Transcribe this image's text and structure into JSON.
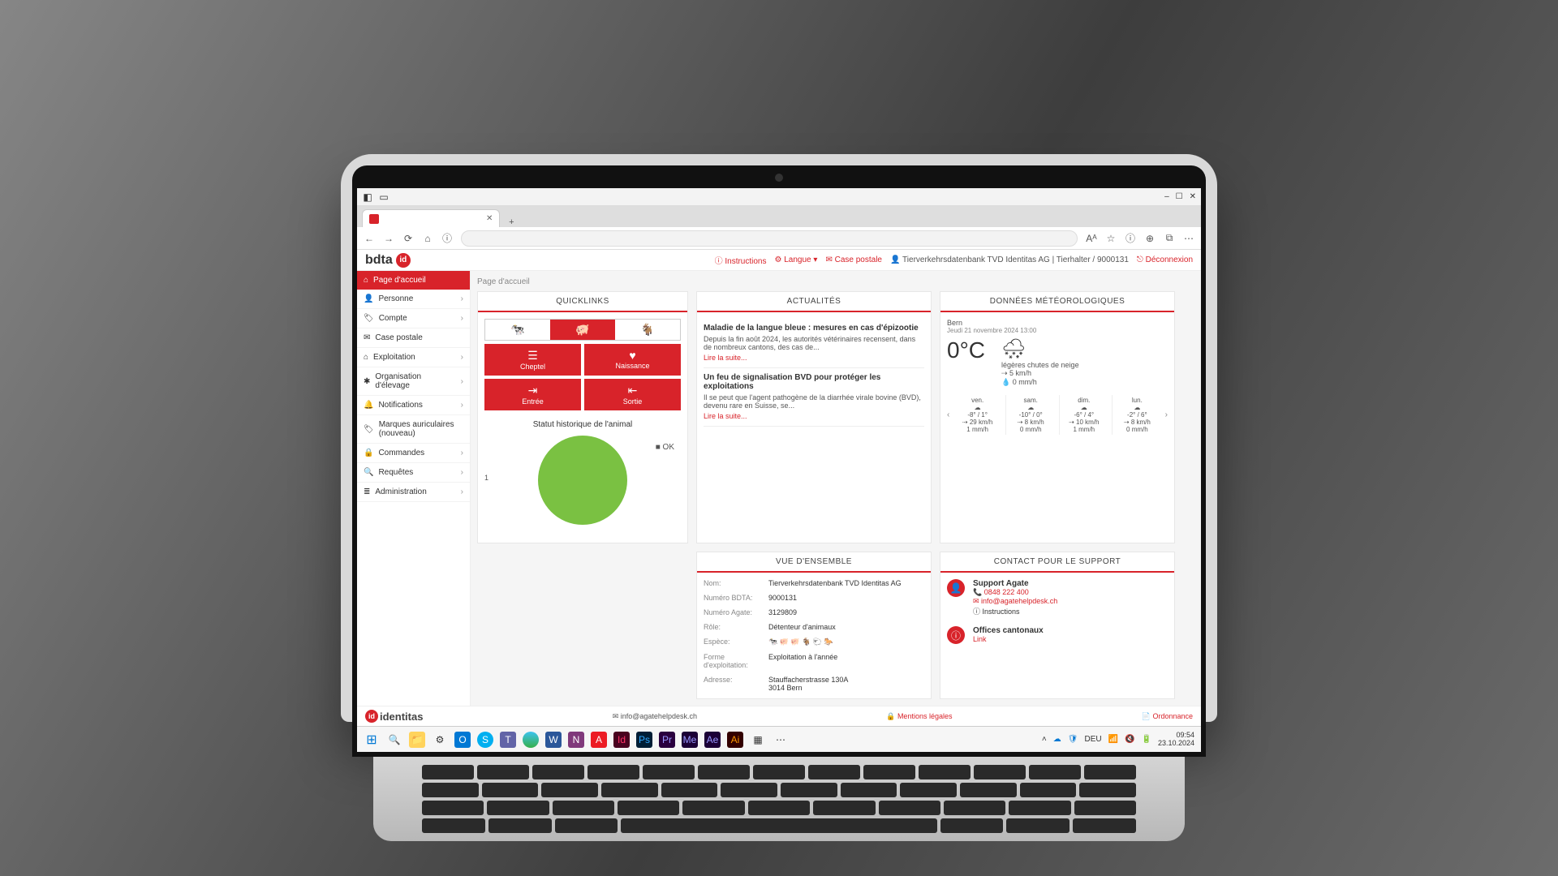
{
  "browser": {
    "window_controls": {
      "min": "–",
      "max": "☐",
      "close": "✕"
    },
    "tab_title": "",
    "tab_close": "✕",
    "new_tab": "+",
    "nav_icons": [
      "←",
      "→",
      "⟳",
      "⌂",
      "ⓘ"
    ],
    "right_icons": [
      "Aᴬ",
      "☆",
      "ⓘ",
      "⊕",
      "⧉",
      "⋯"
    ]
  },
  "header": {
    "logo": "bdta",
    "links": {
      "instructions": "Instructions",
      "langue": "Langue",
      "case_postale": "Case postale",
      "user": "Tierverkehrsdatenbank TVD Identitas AG | Tierhalter / 9000131",
      "deconnexion": "Déconnexion"
    }
  },
  "sidebar": {
    "active": "Page d'accueil",
    "items": [
      "Personne",
      "Compte",
      "Case postale",
      "Exploitation",
      "Organisation d'élevage",
      "Notifications",
      "Marques auriculaires (nouveau)",
      "Commandes",
      "Requêtes",
      "Administration"
    ]
  },
  "breadcrumb": "Page d'accueil",
  "quicklinks": {
    "title": "QUICKLINKS",
    "species_tabs": [
      "🐄",
      "🐖",
      "🐐"
    ],
    "buttons": {
      "cheptel": "Cheptel",
      "naissance": "Naissance",
      "entree": "Entrée",
      "sortie": "Sortie"
    },
    "chart_title": "Statut historique de l'animal",
    "chart_legend": "OK",
    "chart_axis": "1"
  },
  "chart_data": {
    "type": "pie",
    "title": "Statut historique de l'animal",
    "categories": [
      "OK"
    ],
    "values": [
      1
    ],
    "colors": [
      "#7ac142"
    ]
  },
  "news": {
    "title": "ACTUALITÉS",
    "items": [
      {
        "headline": "Maladie de la langue bleue : mesures en cas d'épizootie",
        "snippet": "Depuis la fin août 2024, les autorités vétérinaires recensent, dans de nombreux cantons, des cas de...",
        "link": "Lire la suite..."
      },
      {
        "headline": "Un feu de signalisation BVD pour protéger les exploitations",
        "snippet": "Il se peut que l'agent pathogène de la diarrhée virale bovine (BVD), devenu rare en Suisse, se...",
        "link": "Lire la suite..."
      }
    ]
  },
  "weather": {
    "title": "DONNÉES MÉTÉOROLOGIQUES",
    "location": "Bern",
    "datetime": "Jeudi 21 novembre 2024 13:00",
    "temp": "0",
    "unit": "°C",
    "desc": "légères chutes de neige",
    "wind": "5 km/h",
    "precip": "0 mm/h",
    "forecast": [
      {
        "day": "ven.",
        "icon": "☁",
        "hi": "-8° / 1°",
        "wind": "29 km/h",
        "precip": "1 mm/h"
      },
      {
        "day": "sam.",
        "icon": "☁",
        "hi": "-10° / 0°",
        "wind": "8 km/h",
        "precip": "0 mm/h"
      },
      {
        "day": "dim.",
        "icon": "☁",
        "hi": "-6° / 4°",
        "wind": "10 km/h",
        "precip": "1 mm/h"
      },
      {
        "day": "lun.",
        "icon": "☁",
        "hi": "-2° / 6°",
        "wind": "8 km/h",
        "precip": "0 mm/h"
      }
    ]
  },
  "overview": {
    "title": "VUE D'ENSEMBLE",
    "fields": {
      "nom_label": "Nom:",
      "nom": "Tierverkehrsdatenbank TVD Identitas AG",
      "bdta_label": "Numéro BDTA:",
      "bdta": "9000131",
      "agate_label": "Numéro Agate:",
      "agate": "3129809",
      "role_label": "Rôle:",
      "role": "Détenteur d'animaux",
      "espece_label": "Espèce:",
      "espece": "🐄 🐖 🐖 🐐 🐑 🐎",
      "forme_label": "Forme d'exploitation:",
      "forme": "Exploitation à l'année",
      "adresse_label": "Adresse:",
      "adresse": "Stauffacherstrasse 130A\n3014 Bern"
    }
  },
  "support": {
    "title": "CONTACT POUR LE SUPPORT",
    "agate": {
      "name": "Support Agate",
      "phone": "0848 222 400",
      "email": "info@agatehelpdesk.ch",
      "instructions": "Instructions"
    },
    "cantons": {
      "name": "Offices cantonaux",
      "link": "Link"
    }
  },
  "footer": {
    "brand": "identitas",
    "email": "info@agatehelpdesk.ch",
    "legal": "Mentions légales",
    "ord": "Ordonnance"
  },
  "taskbar": {
    "lang": "DEU",
    "time": "09:54",
    "date": "23.10.2024"
  }
}
